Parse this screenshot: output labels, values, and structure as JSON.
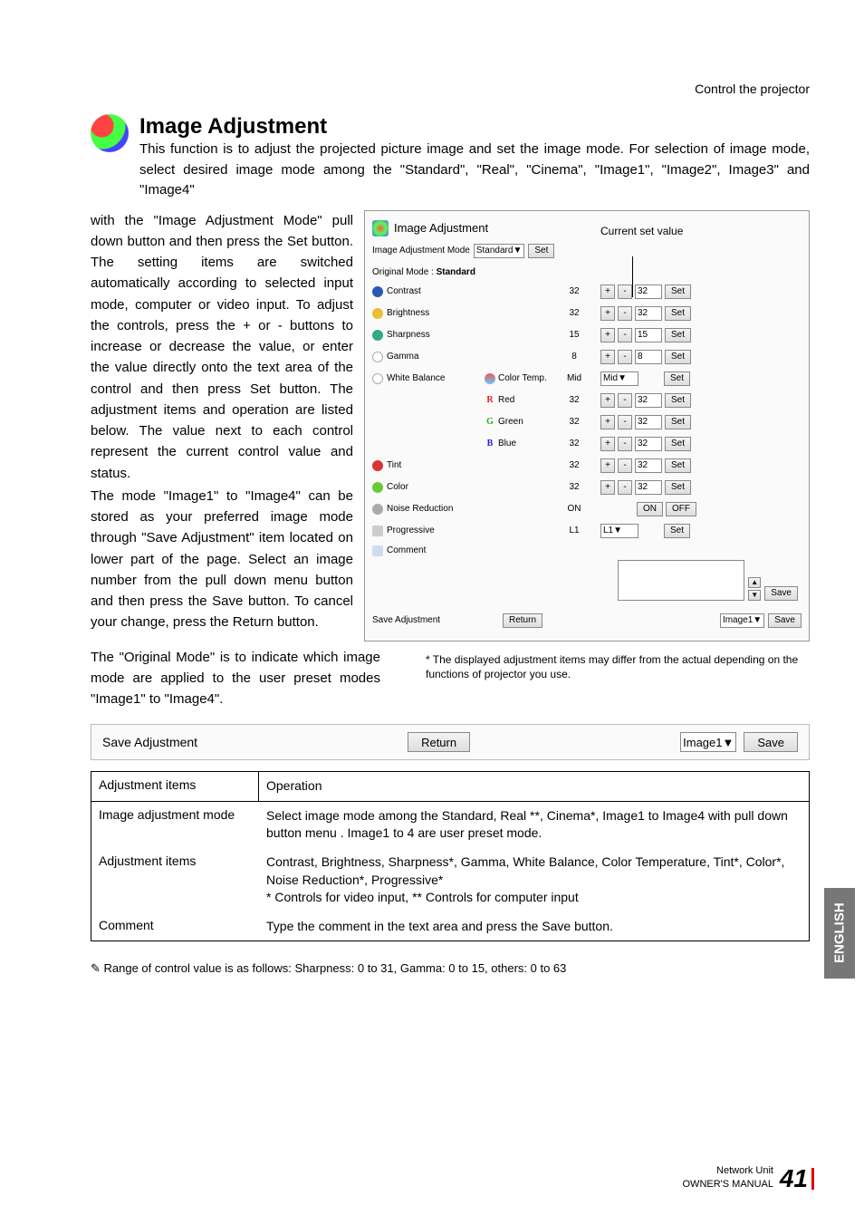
{
  "header_right": "Control the projector",
  "title": "Image Adjustment",
  "intro_line1": "This function is to adjust the projected picture image and set the image mode. For selection of image mode, select desired image mode among the \"Standard\", \"Real\", \"Cinema\", \"Image1\", \"Image2\", Image3\" and \"Image4\"",
  "left_para1": "with the \"Image Adjustment Mode\" pull down button and then press the Set button. The setting items are switched automatically according to selected input mode, computer or video input. To adjust the controls, press the + or - buttons to increase or decrease the value, or enter the value directly onto the text area of the control and then press Set button. The adjustment items and operation are listed below. The value next to each control represent the current control value and status.",
  "left_para2": "The mode \"Image1\" to \"Image4\" can be stored as your preferred image mode through \"Save Adjustment\" item located on lower part of the page. Select an image number from the pull down menu button and then press the Save button. To cancel your change, press the Return button.",
  "after_left": "The \"Original Mode\" is to indicate which image mode are applied to the user preset modes \"Image1\" to \"Image4\".",
  "footnote": "* The displayed adjustment items may differ from the actual depending on the functions of projector you use.",
  "panel": {
    "title": "Image Adjustment",
    "callout": "Current set value",
    "mode_label": "Image Adjustment Mode",
    "mode_value": "Standard",
    "set": "Set",
    "orig_label": "Original Mode :",
    "orig_value": "Standard",
    "rows": {
      "contrast": {
        "label": "Contrast",
        "curr": "32",
        "val": "32"
      },
      "brightness": {
        "label": "Brightness",
        "curr": "32",
        "val": "32"
      },
      "sharpness": {
        "label": "Sharpness",
        "curr": "15",
        "val": "15"
      },
      "gamma": {
        "label": "Gamma",
        "curr": "8",
        "val": "8"
      },
      "wb": {
        "label": "White Balance"
      },
      "colortemp": {
        "label": "Color Temp.",
        "curr": "Mid",
        "val": "Mid"
      },
      "red": {
        "label": "Red",
        "letter": "R",
        "color": "#d22",
        "curr": "32",
        "val": "32"
      },
      "green": {
        "label": "Green",
        "letter": "G",
        "color": "#2a2",
        "curr": "32",
        "val": "32"
      },
      "blue": {
        "label": "Blue",
        "letter": "B",
        "color": "#22d",
        "curr": "32",
        "val": "32"
      },
      "tint": {
        "label": "Tint",
        "curr": "32",
        "val": "32"
      },
      "color": {
        "label": "Color",
        "curr": "32",
        "val": "32"
      },
      "noise": {
        "label": "Noise Reduction",
        "curr": "ON",
        "on": "ON",
        "off": "OFF"
      },
      "prog": {
        "label": "Progressive",
        "curr": "L1",
        "val": "L1"
      },
      "comment": {
        "label": "Comment",
        "save": "Save"
      },
      "saveadj": {
        "label": "Save Adjustment",
        "return": "Return",
        "dd": "Image1",
        "save": "Save"
      }
    }
  },
  "savebar": {
    "label": "Save Adjustment",
    "return": "Return",
    "dd": "Image1",
    "save": "Save"
  },
  "table": {
    "h1": "Adjustment items",
    "h2": "Operation",
    "r1a": "Image adjustment mode",
    "r1b": "Select image mode among the Standard, Real **, Cinema*, Image1 to Image4 with pull down button menu . Image1 to 4 are user preset mode.",
    "r2a": "Adjustment items",
    "r2b": "Contrast, Brightness, Sharpness*, Gamma, White Balance, Color Temperature, Tint*, Color*, Noise Reduction*, Progressive*\n* Controls for video input, ** Controls for computer input",
    "r3a": "Comment",
    "r3b": "Type the comment in the text area and press the Save button."
  },
  "pencil_note": "✎ Range of control value is as follows: Sharpness: 0 to 31, Gamma: 0 to 15, others: 0 to 63",
  "english": "ENGLISH",
  "page_num": "41",
  "footer1": "Network Unit",
  "footer2": "OWNER'S MANUAL"
}
